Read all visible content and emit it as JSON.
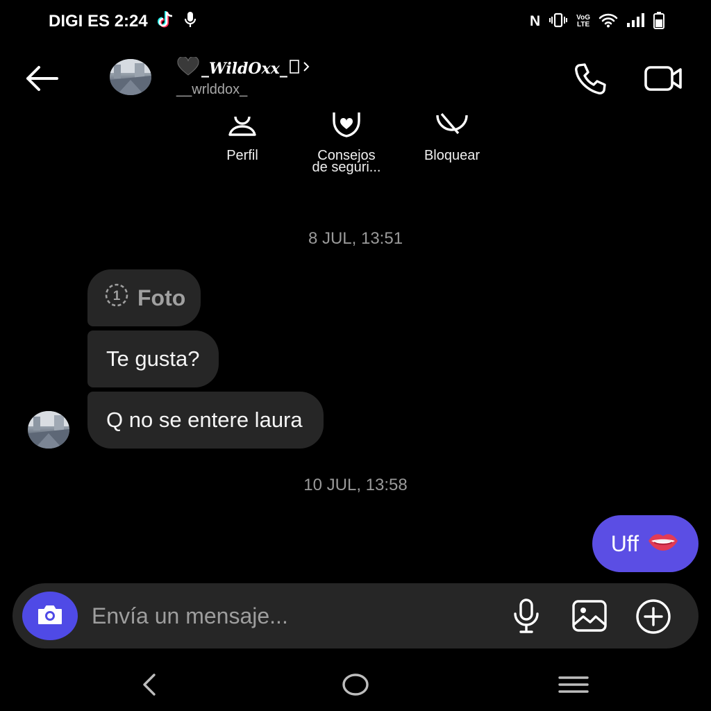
{
  "status_bar": {
    "carrier_time": "DIGI ES 2:24",
    "network_letter": "N",
    "volte_line1": "VoG",
    "volte_line2": "LTE",
    "icons": [
      "tiktok-icon",
      "mic-icon",
      "nfc-icon",
      "vibrate-icon",
      "volte-icon",
      "wifi-icon",
      "signal-icon",
      "battery-icon"
    ]
  },
  "header": {
    "display_name": "_WildOxx_",
    "username": "__wrlddox_",
    "icons": [
      "back-arrow-icon",
      "heart-icon",
      "chevron-right-icon",
      "phone-icon",
      "video-camera-icon"
    ]
  },
  "actions": [
    {
      "label": "Perfil",
      "icon": "profile-icon"
    },
    {
      "label": "Consejos de seguri...",
      "label_line1": "Consejos",
      "label_line2": "de seguri...",
      "icon": "shield-heart-icon"
    },
    {
      "label": "Bloquear",
      "icon": "block-icon"
    }
  ],
  "conversation": {
    "timestamp_1": "8 JUL, 13:51",
    "timestamp_2": "10 JUL, 13:58",
    "messages": [
      {
        "from": "them",
        "kind": "photo",
        "text": "Foto",
        "view_once_count": "1"
      },
      {
        "from": "them",
        "kind": "text",
        "text": "Te gusta?"
      },
      {
        "from": "them",
        "kind": "text",
        "text": "Q no se entere laura"
      },
      {
        "from": "me",
        "kind": "text",
        "text": "Uff",
        "emoji": "biting-lip-emoji"
      }
    ]
  },
  "composer": {
    "placeholder": "Envía un mensaje...",
    "value": "",
    "icons": [
      "camera-icon",
      "microphone-icon",
      "gallery-icon",
      "plus-circle-icon"
    ]
  },
  "nav_bar": {
    "icons": [
      "nav-back-icon",
      "nav-home-icon",
      "nav-recent-icon"
    ]
  },
  "colors": {
    "background": "#000000",
    "bubble_incoming": "#262626",
    "bubble_outgoing": "#5b4ee4",
    "camera_button": "#4f4ae6",
    "text_secondary": "#a8a8a8",
    "timestamp": "#9a9a9a"
  }
}
